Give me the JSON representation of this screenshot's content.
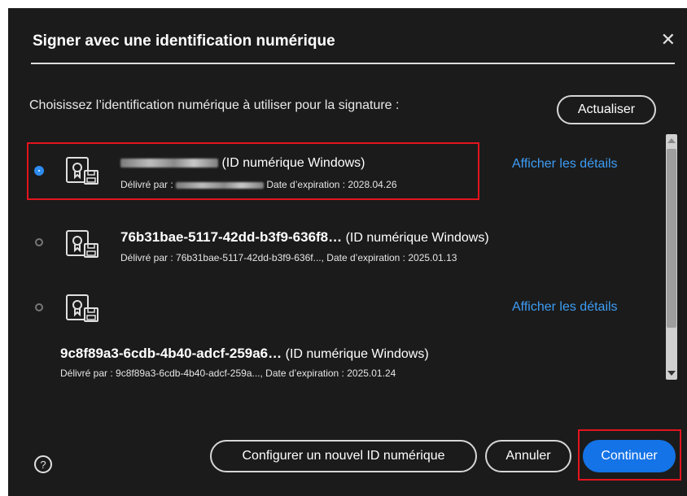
{
  "dialog": {
    "title": "Signer avec une identification numérique",
    "close_icon": "close-icon",
    "prompt": "Choisissez l’identification numérique à utiliser pour la signature :",
    "refresh_label": "Actualiser"
  },
  "ids": [
    {
      "selected": true,
      "name": "",
      "type": "(ID numérique Windows)",
      "issued_by_label": "Délivré par :",
      "issuer": "",
      "expiration": "Date d’expiration : 2028.04.26",
      "details_link": "Afficher les détails"
    },
    {
      "selected": false,
      "name": "76b31bae-5117-42dd-b3f9-636f8…",
      "type": "(ID numérique Windows)",
      "issued_by_label": "Délivré par :",
      "issuer": "76b31bae-5117-42dd-b3f9-636f...,",
      "expiration": "Date d’expiration : 2025.01.13"
    },
    {
      "selected": false,
      "name": "9c8f89a3-6cdb-4b40-adcf-259a6…",
      "type": "(ID numérique Windows)",
      "issued_by_label": "Délivré par :",
      "issuer": "9c8f89a3-6cdb-4b40-adcf-259a...,",
      "expiration": "Date d’expiration : 2025.01.24",
      "details_link": "Afficher les détails"
    }
  ],
  "footer": {
    "help_icon": "help-icon",
    "help_glyph": "?",
    "configure_label": "Configurer un nouvel ID numérique",
    "cancel_label": "Annuler",
    "continue_label": "Continuer"
  },
  "colors": {
    "background": "#1b1b1b",
    "accent": "#1473e6",
    "link": "#3d9df5",
    "highlight_box": "#e3141e"
  }
}
